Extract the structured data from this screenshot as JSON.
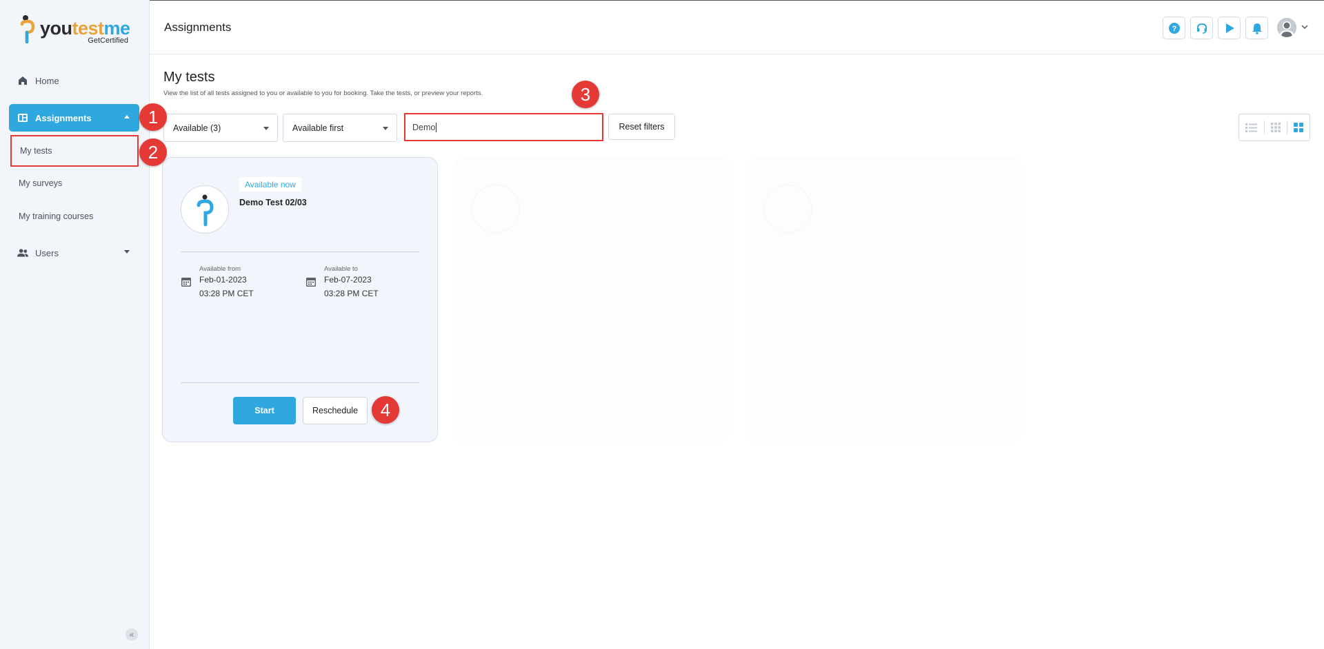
{
  "sidebar": {
    "logo": {
      "part1": "you",
      "part2": "test",
      "part3": "me",
      "sub": "GetCertified"
    },
    "items": {
      "home": "Home",
      "assignments": "Assignments",
      "my_tests": "My tests",
      "my_surveys": "My surveys",
      "my_training_courses": "My training courses",
      "users": "Users"
    },
    "collapse": "«"
  },
  "header": {
    "title": "Assignments",
    "icons": [
      "help-icon",
      "headset-icon",
      "play-icon",
      "bell-icon",
      "user-avatar-icon"
    ]
  },
  "main": {
    "title": "My tests",
    "description": "View the list of all tests assigned to you or available to you for booking. Take the tests, or preview your reports.",
    "filters": {
      "availability": "Available (3)",
      "sort": "Available first",
      "search_value": "Demo",
      "reset_label": "Reset filters"
    }
  },
  "card": {
    "badge": "Available now",
    "title": "Demo Test 02/03",
    "available_from_label": "Available from",
    "available_from_date": "Feb-01-2023",
    "available_from_time": "03:28 PM CET",
    "available_to_label": "Available to",
    "available_to_date": "Feb-07-2023",
    "available_to_time": "03:28 PM CET",
    "start_label": "Start",
    "reschedule_label": "Reschedule"
  },
  "markers": [
    "1",
    "2",
    "3",
    "4"
  ],
  "colors": {
    "accent": "#2fa8e0",
    "highlight": "#e53935",
    "sidebar_bg": "#f2f5f9",
    "card_bg": "#f2f5fb"
  }
}
